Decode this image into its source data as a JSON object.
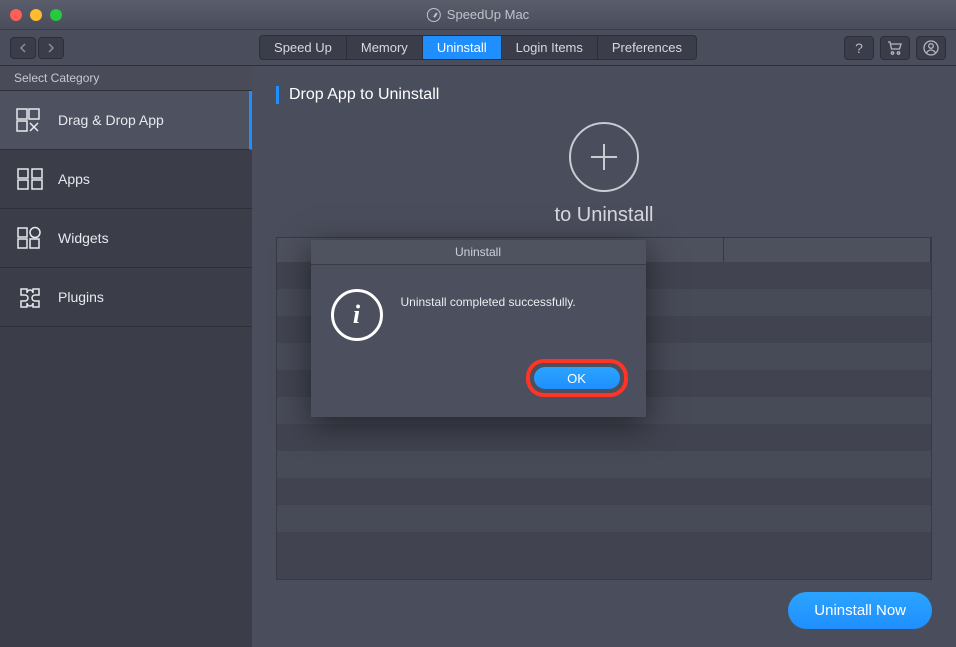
{
  "appTitle": "SpeedUp Mac",
  "tabs": {
    "items": [
      "Speed Up",
      "Memory",
      "Uninstall",
      "Login Items",
      "Preferences"
    ],
    "activeIndex": 2
  },
  "sidebar": {
    "header": "Select Category",
    "items": [
      {
        "label": "Drag & Drop App",
        "icon": "dragdrop"
      },
      {
        "label": "Apps",
        "icon": "apps"
      },
      {
        "label": "Widgets",
        "icon": "widgets"
      },
      {
        "label": "Plugins",
        "icon": "plugins"
      }
    ],
    "activeIndex": 0
  },
  "main": {
    "title": "Drop App to Uninstall",
    "dropText": "to Uninstall",
    "uninstallBtn": "Uninstall Now"
  },
  "modal": {
    "title": "Uninstall",
    "message": "Uninstall completed successfully.",
    "okLabel": "OK"
  }
}
